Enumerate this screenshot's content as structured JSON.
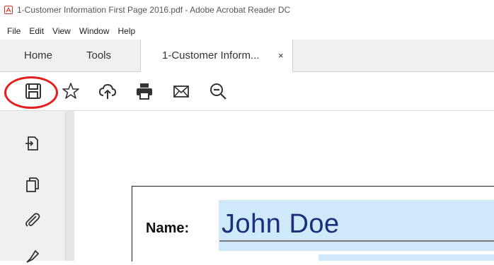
{
  "window": {
    "title": "1-Customer Information First Page 2016.pdf - Adobe Acrobat Reader DC",
    "icon": "pdf-icon"
  },
  "menu": [
    "File",
    "Edit",
    "View",
    "Window",
    "Help"
  ],
  "tabs": {
    "home": "Home",
    "tools": "Tools",
    "document": "1-Customer Inform...",
    "close": "×"
  },
  "toolbar": {
    "icons": [
      "save-icon",
      "bookmark-star-icon",
      "cloud-upload-icon",
      "print-icon",
      "email-icon",
      "zoom-out-icon"
    ],
    "highlight_color": "#e41d1d"
  },
  "leftrail": {
    "icons": [
      "export-pdf-icon",
      "pages-icon",
      "attachment-icon",
      "signature-icon"
    ]
  },
  "document": {
    "name_label": "Name:",
    "name_value": "John Doe",
    "field_color": "#cfe8fa",
    "value_color": "#16317a"
  }
}
